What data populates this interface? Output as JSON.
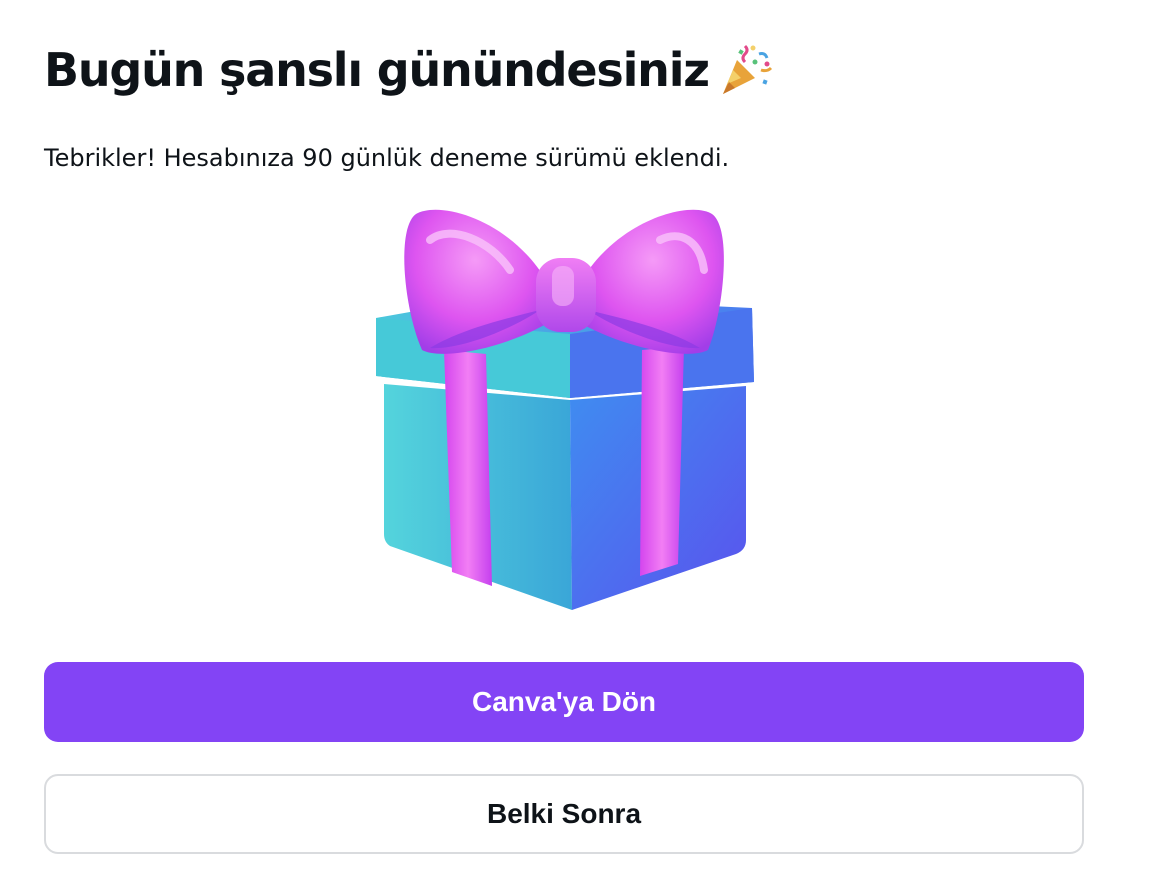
{
  "dialog": {
    "title": "Bugün şanslı günündesiniz",
    "title_icon": "party-popper-icon",
    "message": "Tebrikler! Hesabınıza 90 günlük deneme sürümü eklendi.",
    "illustration": "gift-box-icon",
    "primary_button": "Canva'ya Dön",
    "secondary_button": "Belki Sonra"
  },
  "colors": {
    "primary": "#8344f5",
    "secondary_border": "#d9dbde",
    "text": "#0e1318",
    "ribbon": "#e455f0",
    "box_teal": "#3fc6d8",
    "box_blue": "#4f6df0"
  }
}
